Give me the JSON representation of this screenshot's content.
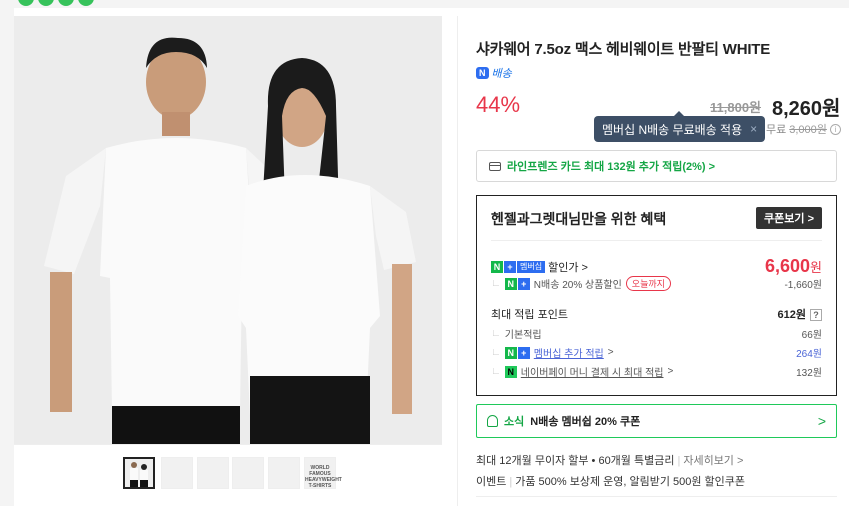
{
  "product": {
    "title": "샤카웨어 7.5oz 맥스 헤비웨이트 반팔티 WHITE",
    "delivery_badge": "N",
    "delivery_label": "배송",
    "discount_pct": "44%",
    "original_price": "11,800원",
    "sale_price": "8,260원"
  },
  "tooltip": {
    "text": "멤버십 N배송 무료배송 적용",
    "close": "×"
  },
  "shipping": {
    "label": "무료",
    "strike": "3,000원",
    "info": "i"
  },
  "card_promo": {
    "text": "라인프렌즈 카드 최대 132원 추가 적립(2%) >"
  },
  "benefit": {
    "title": "헨젤과그렛대님만을 위한 혜택",
    "coupon_button": "쿠폰보기 >",
    "member_price_label": "할인가 >",
    "member_tag": "멤버십",
    "member_price": "6,600",
    "member_price_unit": "원",
    "n_discount_label": "N배송 20% 상품할인",
    "today_tag": "오늘까지",
    "n_discount_value": "-1,660원",
    "points_label": "최대 적립 포인트",
    "points_value": "612원",
    "points_help": "?",
    "basic_label": "기본적립",
    "basic_value": "66원",
    "member_extra_label": "멤버십 추가 적립",
    "member_extra_value": "264원",
    "naverpay_label": "네이버페이 머니 결제 시 최대 적립",
    "naverpay_value": "132원"
  },
  "news": {
    "label": "소식",
    "text": "N배송 멤버쉽 20% 쿠폰",
    "chevron": ">"
  },
  "footer": {
    "installment": "최대 12개월 무이자 할부 • 60개월 특별금리",
    "details": "자세히보기 >",
    "event_label": "이벤트",
    "event_text": "가품 500% 보상제 운영, 알림받기 500원 할인쿠폰"
  },
  "thumbnail_labels": [
    "WORLD FAMOUS HEAVYWEIGHT T-SHIRTS"
  ],
  "colors": {
    "accent_green": "#14a645",
    "discount_red": "#e8364a",
    "tooltip_bg": "#3d4f66"
  }
}
